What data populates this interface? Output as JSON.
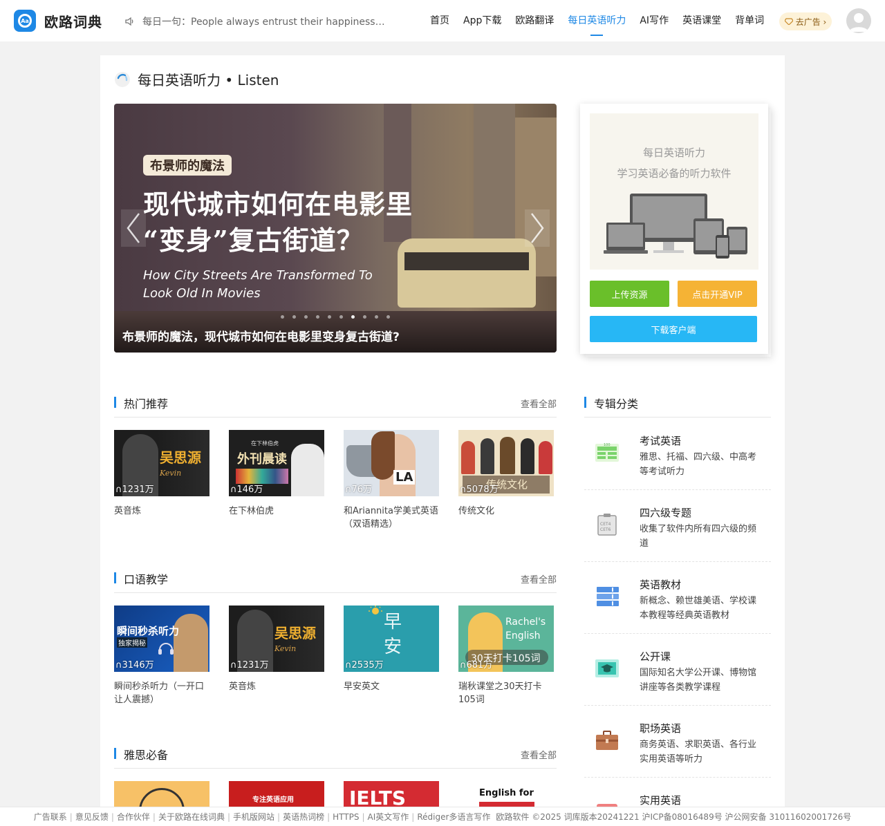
{
  "header": {
    "logo_icon_text": "Aa",
    "logo_text": "欧路词典",
    "daily_sentence": "每日一句：People always entrust their happiness t...",
    "nav": [
      "首页",
      "App下载",
      "欧路翻译",
      "每日英语听力",
      "AI写作",
      "英语课堂",
      "背单词"
    ],
    "active_nav": "每日英语听力",
    "ad_label": "去广告 ›"
  },
  "page_title": "每日英语听力 • Listen",
  "banner": {
    "tag": "布景师的魔法",
    "headline_1": "现代城市如何在电影里",
    "headline_2": "“变身”复古街道？",
    "english_1": "How City Streets Are Transformed To",
    "english_2": "Look Old In Movies",
    "caption": "布景师的魔法，现代城市如何在电影里变身复古街道?",
    "slide_count": 10,
    "active_slide": 6
  },
  "promo": {
    "line1": "每日英语听力",
    "line2": "学习英语必备的听力软件",
    "upload": "上传资源",
    "vip": "点击开通VIP",
    "download": "下载客户端",
    "colors": {
      "upload": "#6abf2a",
      "vip": "#f5b335",
      "download": "#27b7f5"
    }
  },
  "sections": [
    {
      "title": "热门推荐",
      "more": "查看全部",
      "cards": [
        {
          "count": "∩1231万",
          "name": "英音炼",
          "overlay": "吴思源",
          "overlay_sub": "Kevin"
        },
        {
          "count": "∩146万",
          "name": "在下林伯虎",
          "overlay": "外刊晨读",
          "overlay_sub": "在下林伯虎"
        },
        {
          "count": "∩76万",
          "name": "和Ariannita学美式英语（双语精选）",
          "overlay": "LA",
          "overlay_sub": ""
        },
        {
          "count": "∩5078万",
          "name": "传统文化",
          "overlay": "传统文化",
          "overlay_sub": ""
        }
      ]
    },
    {
      "title": "口语教学",
      "more": "查看全部",
      "cards": [
        {
          "count": "∩3146万",
          "name": "瞬间秒杀听力（一开口让人震撼）",
          "overlay": "瞬间秒杀听力",
          "overlay_sub": "独家揭秘"
        },
        {
          "count": "∩1231万",
          "name": "英音炼",
          "overlay": "吴思源",
          "overlay_sub": "Kevin"
        },
        {
          "count": "∩2535万",
          "name": "早安英文",
          "overlay": "早安",
          "overlay_sub": ""
        },
        {
          "count": "∩681万",
          "name": "瑞秋课堂之30天打卡105词",
          "overlay": "Rachel's English",
          "overlay_sub": "30天打卡105词"
        }
      ]
    },
    {
      "title": "雅思必备",
      "more": "查看全部",
      "cards": [
        {
          "count": "",
          "name": "",
          "overlay": "",
          "overlay_sub": ""
        },
        {
          "count": "",
          "name": "",
          "overlay": "专注英语应用",
          "overlay_sub": ""
        },
        {
          "count": "",
          "name": "",
          "overlay": "IELTS",
          "overlay_sub": ""
        },
        {
          "count": "",
          "name": "",
          "overlay": "English for",
          "overlay_sub": ""
        }
      ]
    }
  ],
  "categories": {
    "title": "专辑分类",
    "items": [
      {
        "title": "考试英语",
        "desc": "雅思、托福、四六级、中高考等考试听力",
        "icon": "exam-icon",
        "color": "#6dd36d"
      },
      {
        "title": "四六级专题",
        "desc": "收集了软件内所有四六级的频道",
        "icon": "cet-icon",
        "color": "#9a9a9a"
      },
      {
        "title": "英语教材",
        "desc": "新概念、赖世雄美语、学校课本教程等经典英语教材",
        "icon": "books-icon",
        "color": "#4f8fe3"
      },
      {
        "title": "公开课",
        "desc": "国际知名大学公开课、博物馆讲座等各类教学课程",
        "icon": "graduation-icon",
        "color": "#38c4b0"
      },
      {
        "title": "职场英语",
        "desc": "商务英语、求职英语、各行业实用英语等听力",
        "icon": "briefcase-icon",
        "color": "#b86a44"
      },
      {
        "title": "实用英语",
        "desc": "",
        "icon": "practical-icon",
        "color": "#f08080"
      }
    ]
  },
  "footer": {
    "links": [
      "广告联系",
      "意见反馈",
      "合作伙伴",
      "关于欧路在线词典",
      "手机版网站",
      "英语热词榜",
      "HTTPS",
      "AI英文写作",
      "Rédiger多语言写作"
    ],
    "copyright": "欧路软件 ©2025 词库版本20241221 沪ICP备08016489号 沪公网安备 31011602001726号"
  }
}
